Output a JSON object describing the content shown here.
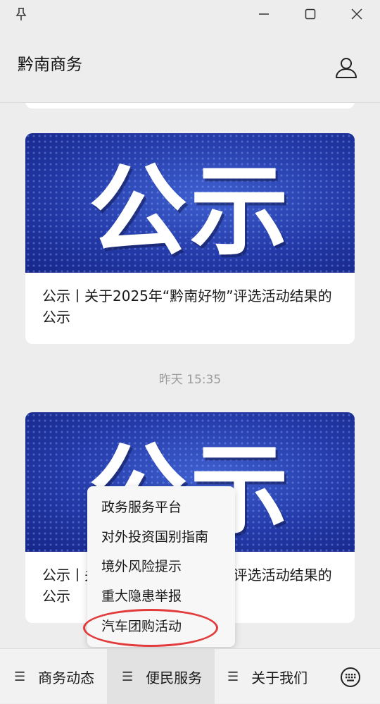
{
  "app": {
    "title": "黔南商务"
  },
  "window_controls": {
    "pin_icon": "pin-icon",
    "minimize_icon": "minimize-icon",
    "maximize_icon": "maximize-icon",
    "close_icon": "close-icon"
  },
  "feed": {
    "articles": [
      {
        "banner_text": "公示",
        "title": "公示丨关于2025年“黔南好物”评选活动结果的公示"
      },
      {
        "banner_text": "公示",
        "title": "公示丨关于2025年“黔南好物”评选活动结果的公示"
      }
    ],
    "timestamp": "昨天 15:35"
  },
  "popup_menu": {
    "items": [
      "政务服务平台",
      "对外投资国别指南",
      "境外风险提示",
      "重大隐患举报",
      "汽车团购活动"
    ],
    "highlight_color": "#e23b3b"
  },
  "bottom_nav": {
    "tabs": [
      {
        "label": "商务动态",
        "icon": "menu-icon"
      },
      {
        "label": "便民服务",
        "icon": "menu-icon"
      },
      {
        "label": "关于我们",
        "icon": "menu-icon"
      }
    ],
    "keyboard_icon": "keyboard-icon"
  }
}
